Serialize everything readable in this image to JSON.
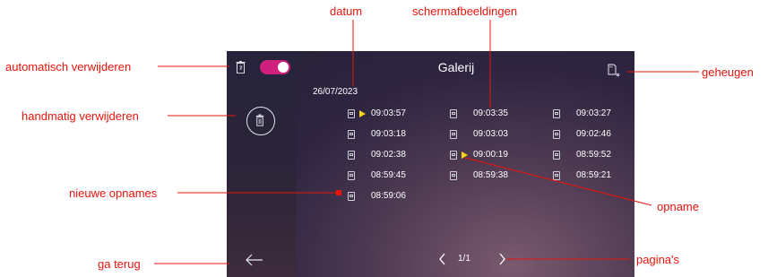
{
  "screen": {
    "title": "Galerij",
    "date": "26/07/2023",
    "recordings": [
      {
        "time": "09:03:57",
        "new": true
      },
      {
        "time": "09:03:35",
        "new": false
      },
      {
        "time": "09:03:27",
        "new": false
      },
      {
        "time": "09:03:18",
        "new": false
      },
      {
        "time": "09:03:03",
        "new": false
      },
      {
        "time": "09:02:46",
        "new": false
      },
      {
        "time": "09:02:38",
        "new": false
      },
      {
        "time": "09:00:19",
        "new": true
      },
      {
        "time": "08:59:52",
        "new": false
      },
      {
        "time": "08:59:45",
        "new": false
      },
      {
        "time": "08:59:38",
        "new": false
      },
      {
        "time": "08:59:21",
        "new": false
      },
      {
        "time": "08:59:06",
        "new": false
      }
    ],
    "auto_delete_enabled": true,
    "pager": "1/1",
    "colors": {
      "accent": "#d0207e",
      "new_marker": "#f7d417",
      "annotation": "#e8140c"
    }
  },
  "annotations": {
    "datum": "datum",
    "schermafbeeldingen": "schermafbeeldingen",
    "automatisch_verwijderen": "automatisch verwijderen",
    "geheugen": "geheugen",
    "handmatig_verwijderen": "handmatig verwijderen",
    "nieuwe_opnames": "nieuwe opnames",
    "opname": "opname",
    "ga_terug": "ga terug",
    "paginas": "pagina's"
  },
  "icons": [
    "trash-icon",
    "toggle-switch",
    "trash-circle-icon",
    "back-arrow-icon",
    "sd-card-icon",
    "chevron-left-icon",
    "chevron-right-icon",
    "recording-icon",
    "play-marker-icon"
  ]
}
